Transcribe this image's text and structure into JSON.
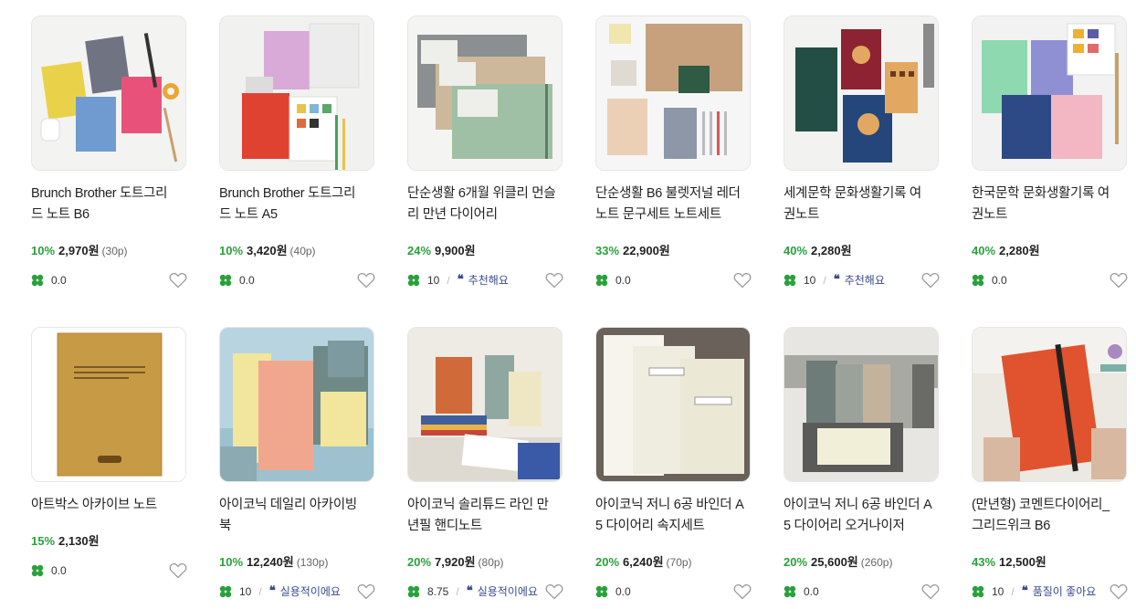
{
  "colors": {
    "discount": "#2aa03c",
    "review": "#3a4a8c",
    "border": "#e6e6e6"
  },
  "icons": {
    "rating": "clover-icon",
    "wishlist": "heart-outline-icon",
    "review": "quote-icon"
  },
  "products": [
    {
      "title": "Brunch Brother 도트그리드 노트 B6",
      "discount": "10%",
      "price": "2,970원",
      "points": "(30p)",
      "rating": "0.0",
      "review": ""
    },
    {
      "title": "Brunch Brother 도트그리드 노트 A5",
      "discount": "10%",
      "price": "3,420원",
      "points": "(40p)",
      "rating": "0.0",
      "review": ""
    },
    {
      "title": "단순생활 6개월 위클리 먼슬리 만년 다이어리",
      "discount": "24%",
      "price": "9,900원",
      "points": "",
      "rating": "10",
      "review": "추천해요"
    },
    {
      "title": "단순생활 B6 불렛저널 레더노트 문구세트 노트세트",
      "discount": "33%",
      "price": "22,900원",
      "points": "",
      "rating": "0.0",
      "review": ""
    },
    {
      "title": "세계문학 문화생활기록 여권노트",
      "discount": "40%",
      "price": "2,280원",
      "points": "",
      "rating": "10",
      "review": "추천해요"
    },
    {
      "title": "한국문학 문화생활기록 여권노트",
      "discount": "40%",
      "price": "2,280원",
      "points": "",
      "rating": "0.0",
      "review": ""
    },
    {
      "title": "아트박스 아카이브 노트",
      "discount": "15%",
      "price": "2,130원",
      "points": "",
      "rating": "0.0",
      "review": ""
    },
    {
      "title": "아이코닉 데일리 아카이빙북",
      "discount": "10%",
      "price": "12,240원",
      "points": "(130p)",
      "rating": "10",
      "review": "실용적이에요"
    },
    {
      "title": "아이코닉 솔리튜드 라인 만년필 핸디노트",
      "discount": "20%",
      "price": "7,920원",
      "points": "(80p)",
      "rating": "8.75",
      "review": "실용적이에요"
    },
    {
      "title": "아이코닉 저니 6공 바인더 A5 다이어리 속지세트",
      "discount": "20%",
      "price": "6,240원",
      "points": "(70p)",
      "rating": "0.0",
      "review": ""
    },
    {
      "title": "아이코닉 저니 6공 바인더 A5 다이어리 오거나이저",
      "discount": "20%",
      "price": "25,600원",
      "points": "(260p)",
      "rating": "0.0",
      "review": ""
    },
    {
      "title": "(만년형) 코멘트다이어리_그리드위크 B6",
      "discount": "43%",
      "price": "12,500원",
      "points": "",
      "rating": "10",
      "review": "품질이 좋아요"
    }
  ]
}
